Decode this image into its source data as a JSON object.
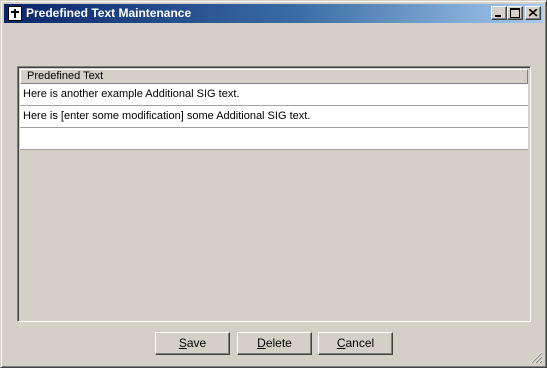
{
  "window": {
    "title": "Predefined Text Maintenance"
  },
  "list": {
    "column_header": "Predefined Text",
    "rows": [
      "Here is another example Additional SIG text.",
      "Here is [enter some modification] some Additional SIG text.",
      ""
    ]
  },
  "buttons": {
    "save": {
      "mnemonic": "S",
      "rest": "ave"
    },
    "delete": {
      "mnemonic": "D",
      "rest": "elete"
    },
    "cancel": {
      "mnemonic": "C",
      "rest": "ancel"
    }
  },
  "colors": {
    "window_bg": "#d4d0c8",
    "title_start": "#0a246a",
    "title_end": "#a6caf0"
  },
  "icons": {
    "app": "app-icon",
    "minimize": "minimize-icon",
    "maximize": "maximize-icon",
    "close": "close-icon",
    "resize": "resize-grip-icon"
  }
}
